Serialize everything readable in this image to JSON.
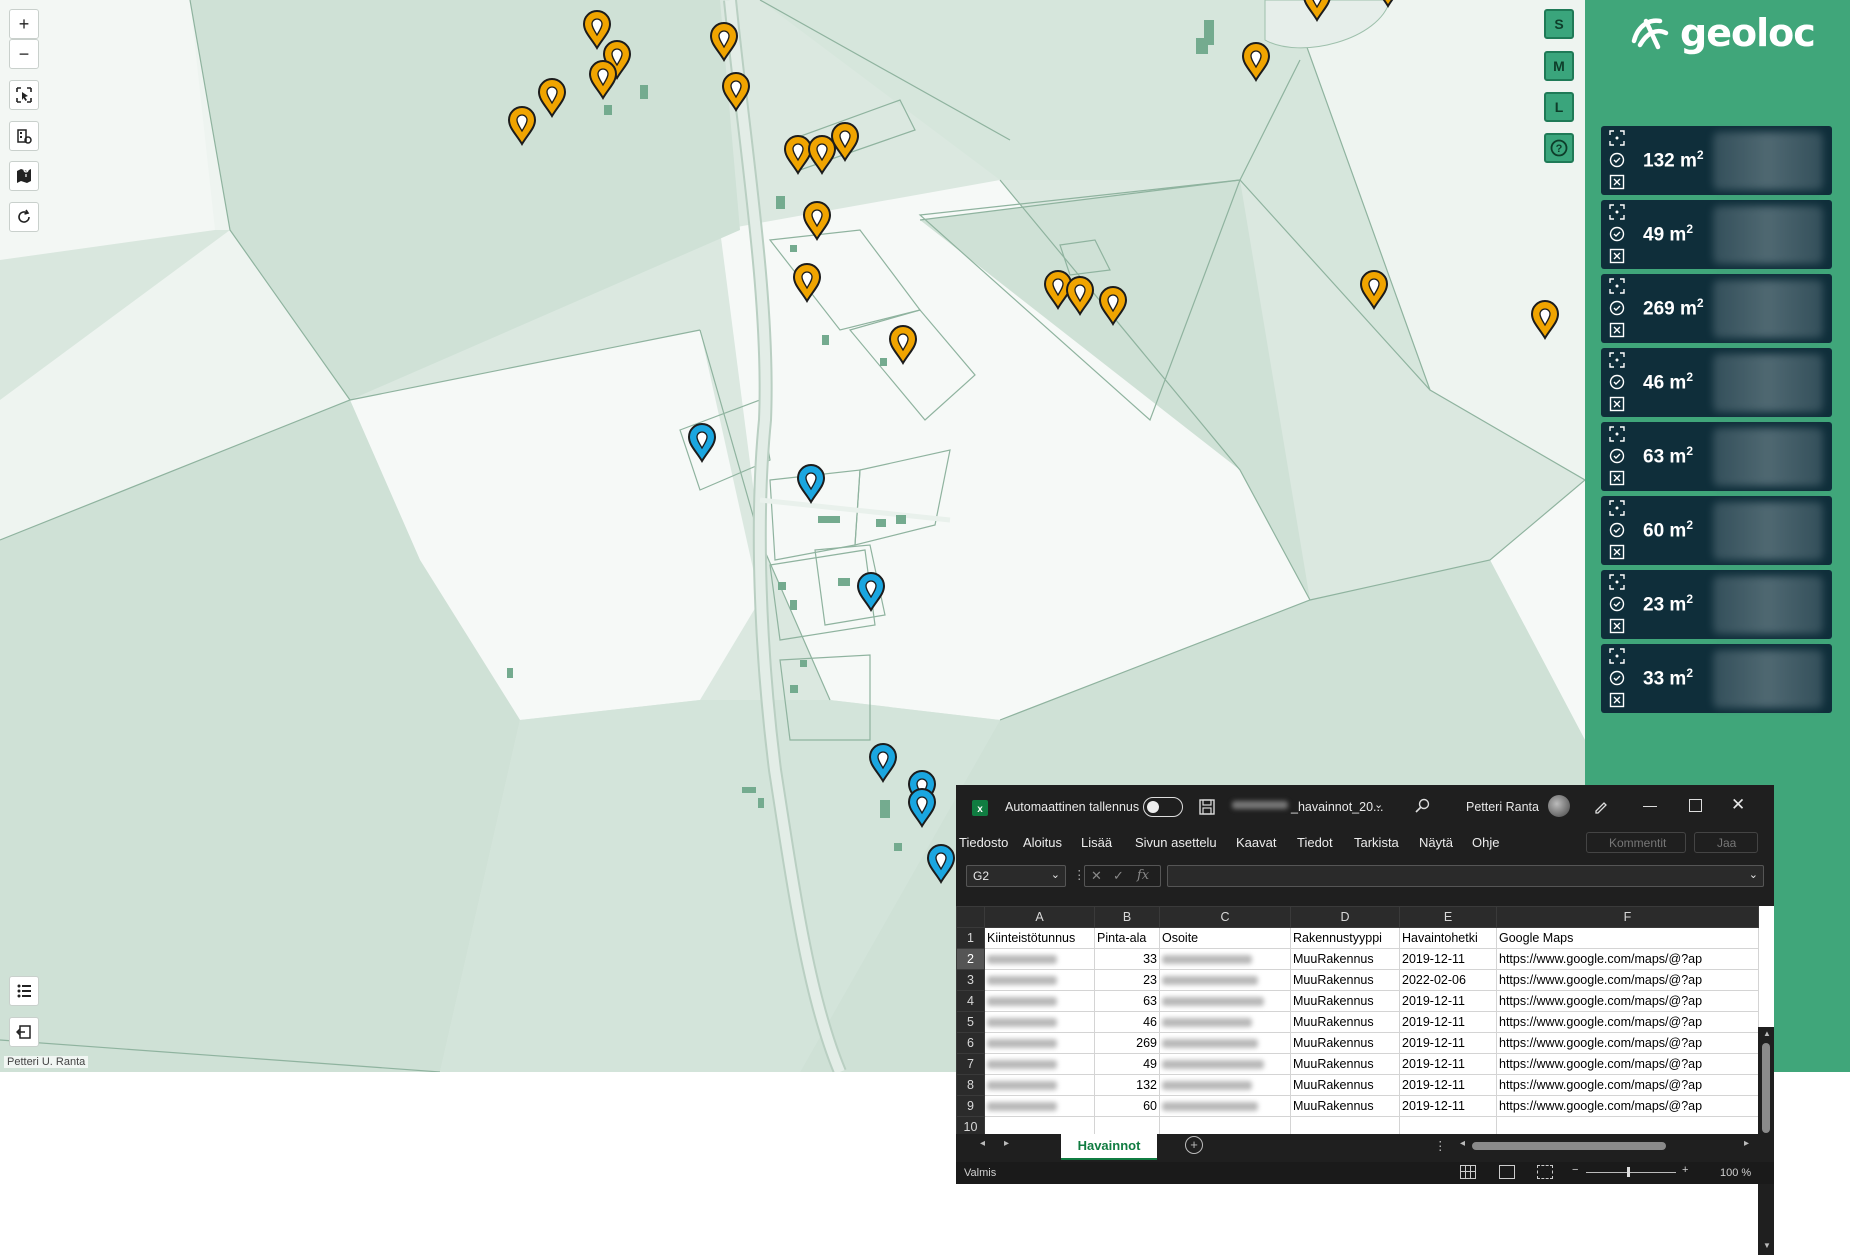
{
  "map": {
    "attribution": "Petteri U. Ranta",
    "controls": {
      "zoom_in": "+",
      "zoom_out": "−"
    },
    "size_buttons": [
      "S",
      "M",
      "L"
    ],
    "colors": {
      "orange_pin": "#f0a400",
      "blue_pin": "#1aa6e0",
      "parcel": "#cfe1d6",
      "field": "#f4f8f5"
    }
  },
  "sidebar": {
    "brand": "geoloc",
    "cards": [
      {
        "area": "132",
        "unit": "m",
        "exp": "2"
      },
      {
        "area": "49",
        "unit": "m",
        "exp": "2"
      },
      {
        "area": "269",
        "unit": "m",
        "exp": "2"
      },
      {
        "area": "46",
        "unit": "m",
        "exp": "2"
      },
      {
        "area": "63",
        "unit": "m",
        "exp": "2"
      },
      {
        "area": "60",
        "unit": "m",
        "exp": "2"
      },
      {
        "area": "23",
        "unit": "m",
        "exp": "2"
      },
      {
        "area": "33",
        "unit": "m",
        "exp": "2"
      }
    ]
  },
  "excel": {
    "autosave_label": "Automaattinen tallennus",
    "filename": "_havainnot_20...",
    "user": "Petteri Ranta",
    "menu": [
      "Tiedosto",
      "Aloitus",
      "Lisää",
      "Sivun asettelu",
      "Kaavat",
      "Tiedot",
      "Tarkista",
      "Näytä",
      "Ohje"
    ],
    "comments": "Kommentit",
    "share": "Jaa",
    "namebox": "G2",
    "fx": "fx",
    "columns": [
      "A",
      "B",
      "C",
      "D",
      "E",
      "F"
    ],
    "header_row": {
      "num": "1",
      "cells": [
        "Kiinteistötunnus",
        "Pinta-ala",
        "Osoite",
        "Rakennustyyppi",
        "Havaintohetki",
        "Google Maps"
      ]
    },
    "rows": [
      {
        "num": "2",
        "area": "33",
        "type": "MuuRakennus",
        "date": "2019-12-11",
        "link": "https://www.google.com/maps/@?ap"
      },
      {
        "num": "3",
        "area": "23",
        "type": "MuuRakennus",
        "date": "2022-02-06",
        "link": "https://www.google.com/maps/@?ap"
      },
      {
        "num": "4",
        "area": "63",
        "type": "MuuRakennus",
        "date": "2019-12-11",
        "link": "https://www.google.com/maps/@?ap"
      },
      {
        "num": "5",
        "area": "46",
        "type": "MuuRakennus",
        "date": "2019-12-11",
        "link": "https://www.google.com/maps/@?ap"
      },
      {
        "num": "6",
        "area": "269",
        "type": "MuuRakennus",
        "date": "2019-12-11",
        "link": "https://www.google.com/maps/@?ap"
      },
      {
        "num": "7",
        "area": "49",
        "type": "MuuRakennus",
        "date": "2019-12-11",
        "link": "https://www.google.com/maps/@?ap"
      },
      {
        "num": "8",
        "area": "132",
        "type": "MuuRakennus",
        "date": "2019-12-11",
        "link": "https://www.google.com/maps/@?ap"
      },
      {
        "num": "9",
        "area": "60",
        "type": "MuuRakennus",
        "date": "2019-12-11",
        "link": "https://www.google.com/maps/@?ap"
      }
    ],
    "empty_row": "10",
    "sheet_tab": "Havainnot",
    "status": "Valmis",
    "zoom": "100 %"
  }
}
